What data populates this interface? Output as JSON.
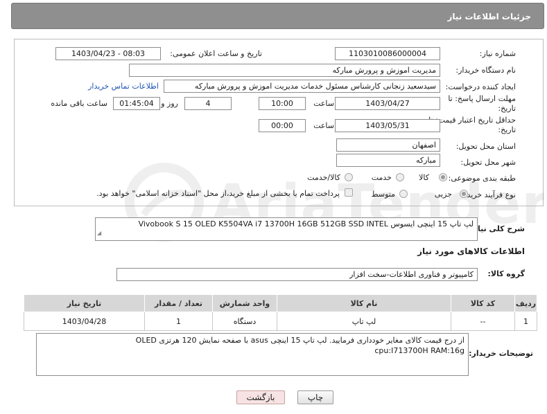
{
  "header": {
    "title": "جزئیات اطلاعات نیاز"
  },
  "form": {
    "need_number": {
      "label": "شماره نیاز:",
      "value": "1103010086000004"
    },
    "announce_date": {
      "label": "تاریخ و ساعت اعلان عمومی:",
      "value": "1403/04/23 - 08:03"
    },
    "buyer_org": {
      "label": "نام دستگاه خریدار:",
      "value": "مدیریت اموزش و پرورش مبارکه"
    },
    "requester": {
      "label": "ایجاد کننده درخواست:",
      "value": "سیدسعید زنجانی کارشناس مسئول خدمات مدیریت اموزش و پرورش مبارکه",
      "contact_link": "اطلاعات تماس خریدار"
    },
    "reply_deadline": {
      "label_line1": "مهلت ارسال پاسخ: تا",
      "label_line2": "تاریخ:",
      "date": "1403/04/27",
      "time_label": "ساعت",
      "time": "10:00",
      "days": "4",
      "days_label": "روز و",
      "remaining": "01:45:04",
      "remaining_label": "ساعت باقی مانده"
    },
    "price_validity": {
      "label_line1": "حداقل تاریخ اعتبار قیمت: تا",
      "label_line2": "تاریخ:",
      "date": "1403/05/31",
      "time_label": "ساعت",
      "time": "00:00"
    },
    "province": {
      "label": "استان محل تحویل:",
      "value": "اصفهان"
    },
    "city": {
      "label": "شهر محل تحویل:",
      "value": "مبارکه"
    },
    "category": {
      "label": "طبقه بندی موضوعی:",
      "options": [
        "کالا",
        "خدمت",
        "کالا/خدمت"
      ],
      "selected": "کالا"
    },
    "purchase_type": {
      "label": "نوع فرآیند خرید :",
      "options": [
        "جزیی",
        "متوسط"
      ],
      "selected": "جزیی",
      "treasury_note": "پرداخت تمام یا بخشی از مبلغ خرید،از محل \"اسناد خزانه اسلامی\" خواهد بود."
    }
  },
  "description": {
    "label": "شرح کلی نیاز:",
    "value": "لپ تاپ 15 اینچی ایسوس Vivobook S 15 OLED K5504VA i7 13700H 16GB 512GB SSD INTEL"
  },
  "goods_section": {
    "title": "اطلاعات کالاهای مورد نیاز"
  },
  "goods_group": {
    "label": "گروه کالا:",
    "value": "کامپیوتر و فناوری اطلاعات-سخت افزار"
  },
  "table": {
    "headers": [
      "ردیف",
      "کد کالا",
      "نام کالا",
      "واحد شمارش",
      "تعداد / مقدار",
      "تاریخ نیاز"
    ],
    "rows": [
      [
        "1",
        "--",
        "لپ تاپ",
        "دستگاه",
        "1",
        "1403/04/28"
      ]
    ]
  },
  "buyer_notes": {
    "label": "توضیحات خریدار:",
    "line1": "از درج قیمت کالای مغایر خودداری فرمایید. لپ تاپ 15 اینچی asus با صفحه نمایش 120 هرتزی OLED",
    "line2": "cpu:I713700H RAM:16g"
  },
  "buttons": {
    "print": "چاپ",
    "back": "بازگشت"
  },
  "watermark": {
    "text": "AriaTender.net"
  },
  "colors": {
    "header_bg": "#8f8f8f",
    "link": "#1e56b4",
    "back_button_bg": "#f7e3e3"
  }
}
